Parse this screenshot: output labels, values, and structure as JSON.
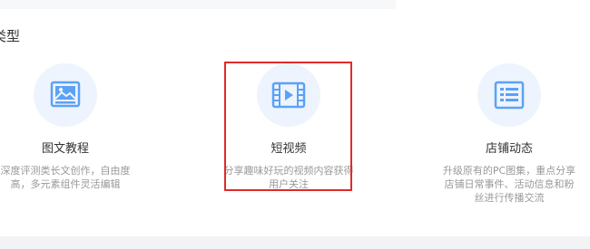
{
  "section": {
    "title": "类型"
  },
  "cards": [
    {
      "name": "图文教程",
      "desc_line1": "深度评测类长文创作，自由度",
      "desc_line2": "高，多元素组件灵活编辑",
      "desc_line3": "",
      "icon": "image-doc-icon"
    },
    {
      "name": "短视频",
      "desc_line1": "分享趣味好玩的视频内容获得",
      "desc_line2": "用户关注",
      "desc_line3": "",
      "icon": "video-film-icon"
    },
    {
      "name": "店铺动态",
      "desc_line1": "升级原有的PC图集，重点分享",
      "desc_line2": "店铺日常事件、活动信息和粉",
      "desc_line3": "丝进行传播交流",
      "icon": "list-doc-icon"
    }
  ],
  "colors": {
    "icon_blue": "#5aa2f7",
    "circle_bg": "#eef4fd",
    "highlight": "#e02a2a"
  }
}
